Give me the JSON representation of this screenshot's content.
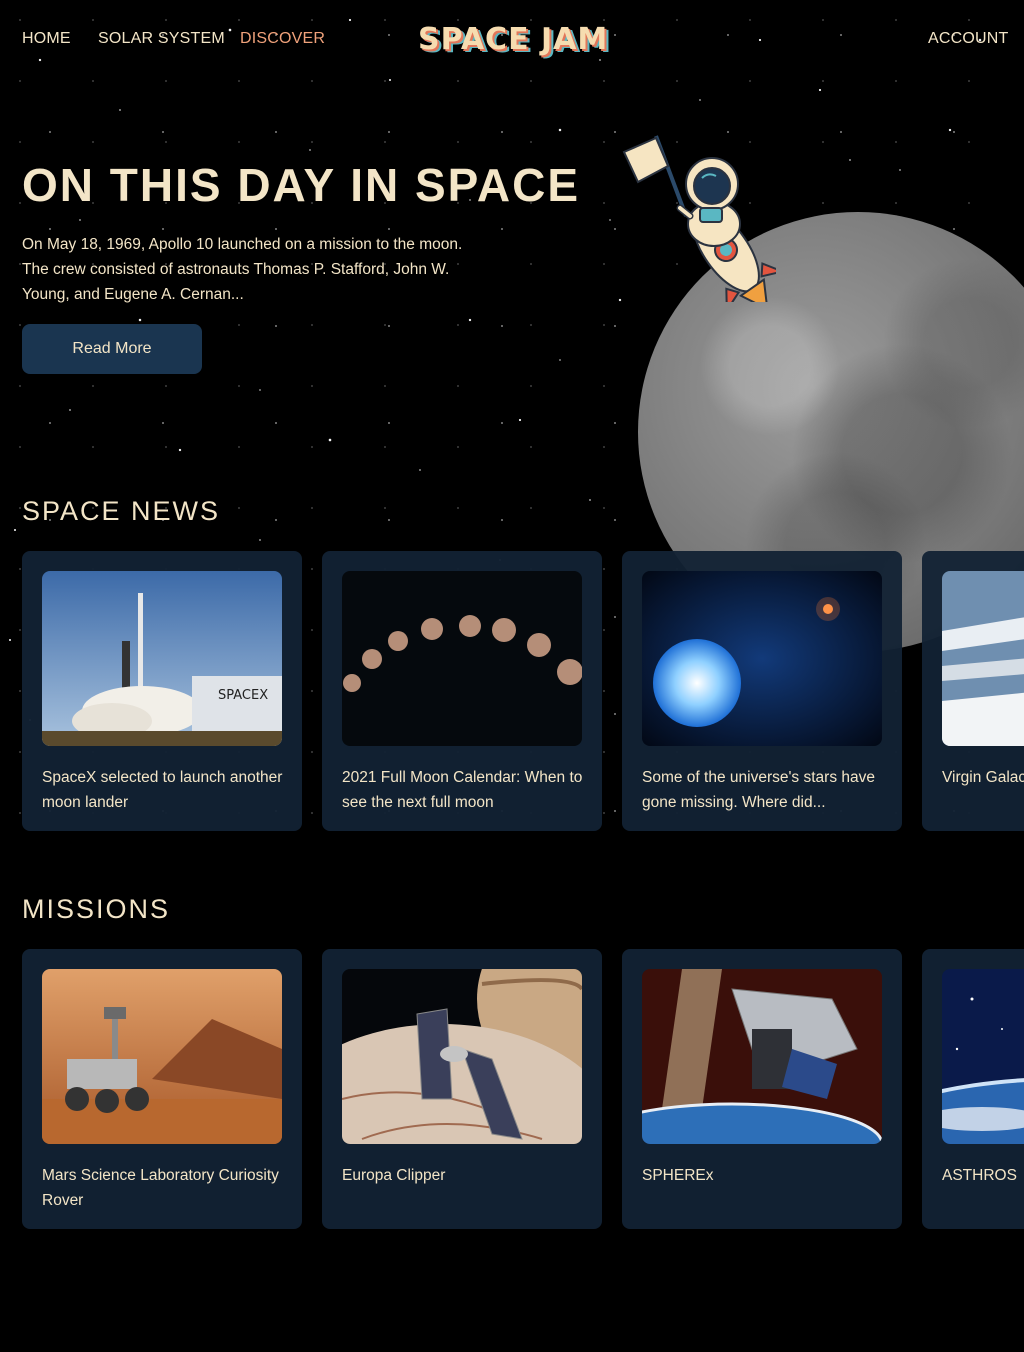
{
  "nav": {
    "links": [
      "HOME",
      "SOLAR SYSTEM",
      "DISCOVER"
    ],
    "active": "DISCOVER",
    "logo": "SPACE JAM",
    "account": "ACCOUNT"
  },
  "hero": {
    "title": "ON THIS DAY IN SPACE",
    "text": "On May 18, 1969, Apollo 10 launched on a mission to the moon. The crew consisted of astronauts Thomas P. Stafford, John W. Young, and Eugene A. Cernan...",
    "button": "Read More"
  },
  "news": {
    "title": "SPACE NEWS",
    "items": [
      {
        "title": "SpaceX selected to launch another moon lander",
        "image": "rocket-launch-image"
      },
      {
        "title": "2021 Full Moon Calendar: When to see the next full moon",
        "image": "moon-phases-image"
      },
      {
        "title": "Some of the universe's stars have gone missing. Where did...",
        "image": "blue-star-image"
      },
      {
        "title": "Virgin Galactic next SpaceShip",
        "image": "spaceplane-image"
      }
    ]
  },
  "missions": {
    "title": "MISSIONS",
    "items": [
      {
        "title": "Mars Science Laboratory Curiosity Rover",
        "image": "mars-rover-image"
      },
      {
        "title": "Europa Clipper",
        "image": "europa-clipper-image"
      },
      {
        "title": "SPHEREx",
        "image": "spherex-telescope-image"
      },
      {
        "title": "ASTHROS",
        "image": "earth-from-space-image"
      }
    ]
  },
  "colors": {
    "background": "#000000",
    "text": "#f3e5c7",
    "active_nav": "#f0a27b",
    "card": "#122234",
    "button": "#1a3550"
  }
}
